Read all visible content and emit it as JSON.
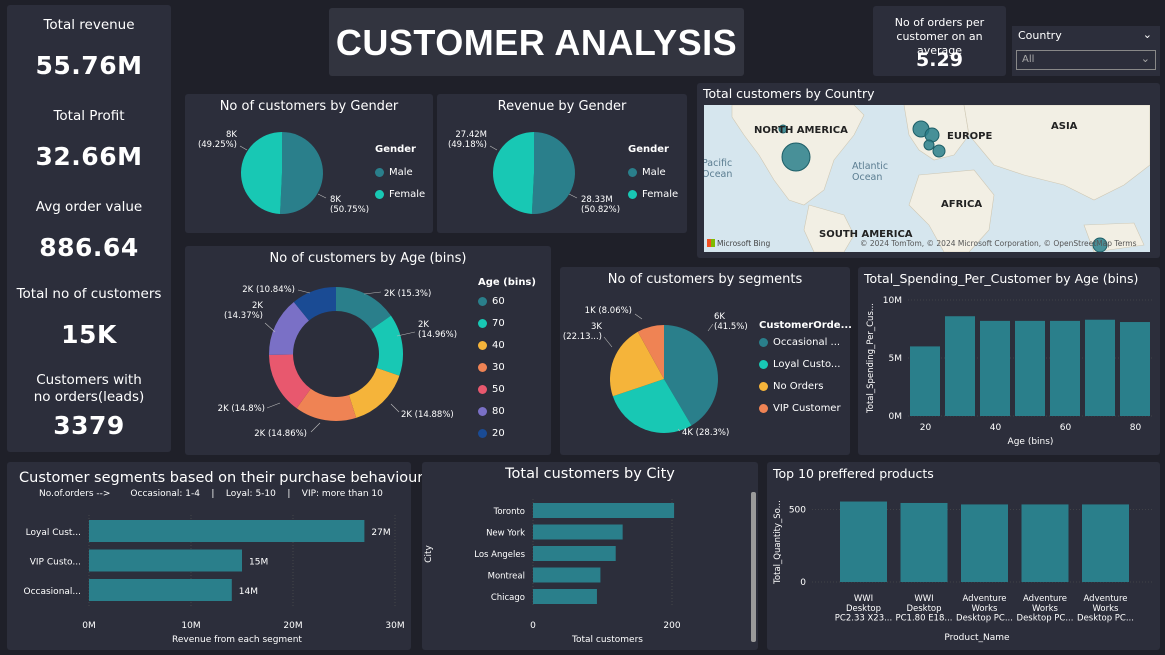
{
  "colors": {
    "teal": "#2a7f8b",
    "teal2": "#18c8b4",
    "orange": "#f0a23c",
    "amber": "#f5b43a",
    "salmon": "#ef8354",
    "red": "#e8586e",
    "purple": "#7a70c6",
    "navy": "#1a4b94",
    "bar": "#2a7f8b"
  },
  "kpis": [
    {
      "title": "Total revenue",
      "value": "55.76M"
    },
    {
      "title": "Total Profit",
      "value": "32.66M"
    },
    {
      "title": "Avg order value",
      "value": "886.64"
    },
    {
      "title": "Total no of customers",
      "value": "15K"
    },
    {
      "title": "Customers with no orders(leads)",
      "value": "3379"
    }
  ],
  "header": {
    "title": "CUSTOMER ANALYSIS"
  },
  "avg_orders": {
    "title": "No of orders per customer on an average",
    "value": "5.29"
  },
  "country_filter": {
    "label": "Country",
    "value": "All"
  },
  "map": {
    "title": "Total customers by Country",
    "labels": [
      "NORTH AMERICA",
      "EUROPE",
      "ASIA",
      "AFRICA",
      "SOUTH AMERICA",
      "Pacific Ocean",
      "Atlantic Ocean"
    ],
    "attribution": "© 2024 TomTom, © 2024 Microsoft Corporation, © OpenStreetMap Terms",
    "logo": "Microsoft Bing"
  },
  "chart_data": [
    {
      "id": "gender_customers",
      "type": "pie",
      "title": "No of customers by Gender",
      "legend_title": "Gender",
      "categories": [
        "Male",
        "Female"
      ],
      "values": [
        50.75,
        49.25
      ],
      "labels": [
        "8K\n(50.75%)",
        "8K\n(49.25%)"
      ]
    },
    {
      "id": "gender_revenue",
      "type": "pie",
      "title": "Revenue by Gender",
      "legend_title": "Gender",
      "categories": [
        "Male",
        "Female"
      ],
      "values": [
        50.82,
        49.18
      ],
      "labels": [
        "28.33M\n(50.82%)",
        "27.42M\n(49.18%)"
      ]
    },
    {
      "id": "age_customers",
      "type": "pie",
      "title": "No of customers by Age (bins)",
      "legend_title": "Age (bins)",
      "categories": [
        "60",
        "70",
        "40",
        "30",
        "50",
        "80",
        "20"
      ],
      "values": [
        15.3,
        14.96,
        14.88,
        14.86,
        14.8,
        14.37,
        10.84
      ],
      "labels": [
        "2K (15.3%)",
        "2K\n(14.96%)",
        "2K (14.88%)",
        "2K (14.86%)",
        "2K (14.8%)",
        "2K\n(14.37%)",
        "2K (10.84%)"
      ]
    },
    {
      "id": "segments",
      "type": "pie",
      "title": "No of customers by segments",
      "legend_title": "CustomerOrde...",
      "categories": [
        "Occasional ...",
        "Loyal Custo...",
        "No Orders",
        "VIP Customer"
      ],
      "values": [
        41.5,
        28.3,
        22.13,
        8.06
      ],
      "labels": [
        "6K\n(41.5%)",
        "4K (28.3%)",
        "3K\n(22.13...)",
        "1K (8.06%)"
      ]
    },
    {
      "id": "spending_by_age",
      "type": "bar",
      "title": "Total_Spending_Per_Customer by Age (bins)",
      "x": [
        20,
        30,
        40,
        50,
        60,
        70,
        80
      ],
      "values": [
        6.0,
        8.6,
        8.2,
        8.2,
        8.2,
        8.3,
        8.1
      ],
      "xlabel": "Age (bins)",
      "ylabel": "Total_Spending_Per_Cus...",
      "ylim": [
        0,
        10
      ],
      "yticks": [
        "0M",
        "5M",
        "10M"
      ],
      "xticks": [
        "20",
        "40",
        "60",
        "80"
      ]
    },
    {
      "id": "segment_revenue",
      "type": "bar",
      "title": "Customer segments based on their purchase behaviour",
      "subtitle": "No.of.orders -->       Occasional: 1-4    |    Loyal: 5-10    |    VIP: more than 10",
      "categories": [
        "Loyal Cust...",
        "VIP Custo...",
        "Occasional..."
      ],
      "values": [
        27,
        15,
        14
      ],
      "value_labels": [
        "27M",
        "15M",
        "14M"
      ],
      "xlabel": "Revenue from each segment",
      "xlim": [
        0,
        30
      ],
      "xticks": [
        "0M",
        "10M",
        "20M",
        "30M"
      ]
    },
    {
      "id": "city_customers",
      "type": "bar",
      "title": "Total customers by City",
      "categories": [
        "Toronto",
        "New York",
        "Los Angeles",
        "Montreal",
        "Chicago"
      ],
      "values": [
        203,
        129,
        119,
        97,
        92
      ],
      "xlabel": "Total customers",
      "ylabel": "City",
      "xlim": [
        0,
        200
      ],
      "xticks": [
        "0",
        "200"
      ]
    },
    {
      "id": "top_products",
      "type": "bar",
      "title": "Top 10 preffered products",
      "categories": [
        "WWI Desktop PC2.33 X23...",
        "WWI Desktop PC1.80 E18...",
        "Adventure Works Desktop PC...",
        "Adventure Works Desktop PC...",
        "Adventure Works Desktop PC..."
      ],
      "category_lines": [
        [
          "WWI",
          "Desktop",
          "PC2.33 X23..."
        ],
        [
          "WWI",
          "Desktop",
          "PC1.80 E18..."
        ],
        [
          "Adventure",
          "Works",
          "Desktop PC..."
        ],
        [
          "Adventure",
          "Works",
          "Desktop PC..."
        ],
        [
          "Adventure",
          "Works",
          "Desktop PC..."
        ]
      ],
      "values": [
        555,
        545,
        535,
        535,
        535
      ],
      "xlabel": "Product_Name",
      "ylabel": "Total_Quantity_So...",
      "ylim": [
        0,
        600
      ],
      "yticks": [
        "0",
        "500"
      ]
    }
  ]
}
